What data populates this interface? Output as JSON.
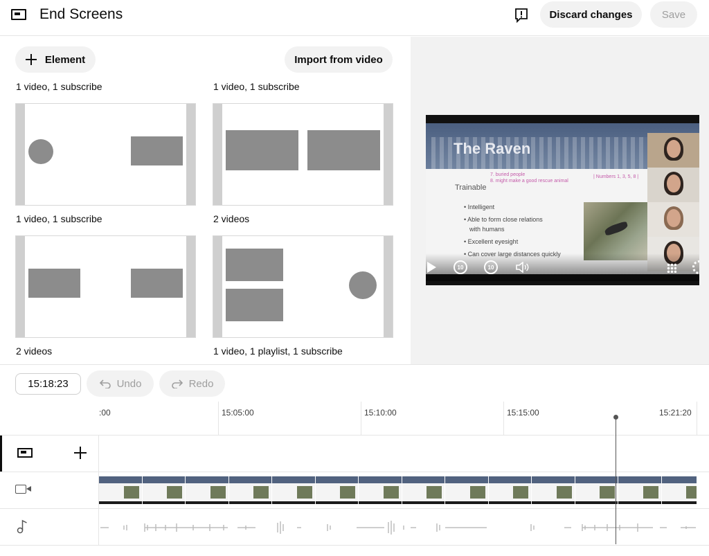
{
  "header": {
    "title": "End Screens",
    "discard_label": "Discard changes",
    "save_label": "Save"
  },
  "left_panel": {
    "element_label": "Element",
    "import_label": "Import from video",
    "current_left_caption": "1 video, 1 subscribe",
    "current_right_caption": "1 video, 1 subscribe",
    "templates": [
      {
        "caption": "1 video, 1 subscribe"
      },
      {
        "caption": "2 videos"
      },
      {
        "caption": "2 videos"
      },
      {
        "caption": "1 video, 1 playlist, 1 subscribe"
      }
    ]
  },
  "preview": {
    "slide_title": "The Raven",
    "slide_subtitle": "Trainable",
    "pink_note_1": "7. buried people",
    "pink_note_2": "8. might make a good rescue animal",
    "pink_note_3": "| Numbers 1, 3, 5, 8 |",
    "bullets": [
      "• Intelligent",
      "• Able to form close relations",
      "with humans",
      "• Excellent eyesight",
      "• Can cover large distances quickly"
    ],
    "rewind_label": "10",
    "forward_label": "10"
  },
  "timeline": {
    "timecode": "15:18:23",
    "undo_label": "Undo",
    "redo_label": "Redo",
    "ticks": [
      ":00",
      "15:05:00",
      "15:10:00",
      "15:15:00",
      "15:21:20"
    ]
  },
  "colors": {
    "pill_bg": "#f2f2f2",
    "template_block": "#8c8c8c",
    "accent_dark": "#0d0d0d"
  },
  "icons": {
    "header": "end-screen-icon",
    "feedback": "feedback-icon",
    "add": "plus-icon",
    "video_track": "video-camera-icon",
    "audio_track": "music-note-icon"
  }
}
